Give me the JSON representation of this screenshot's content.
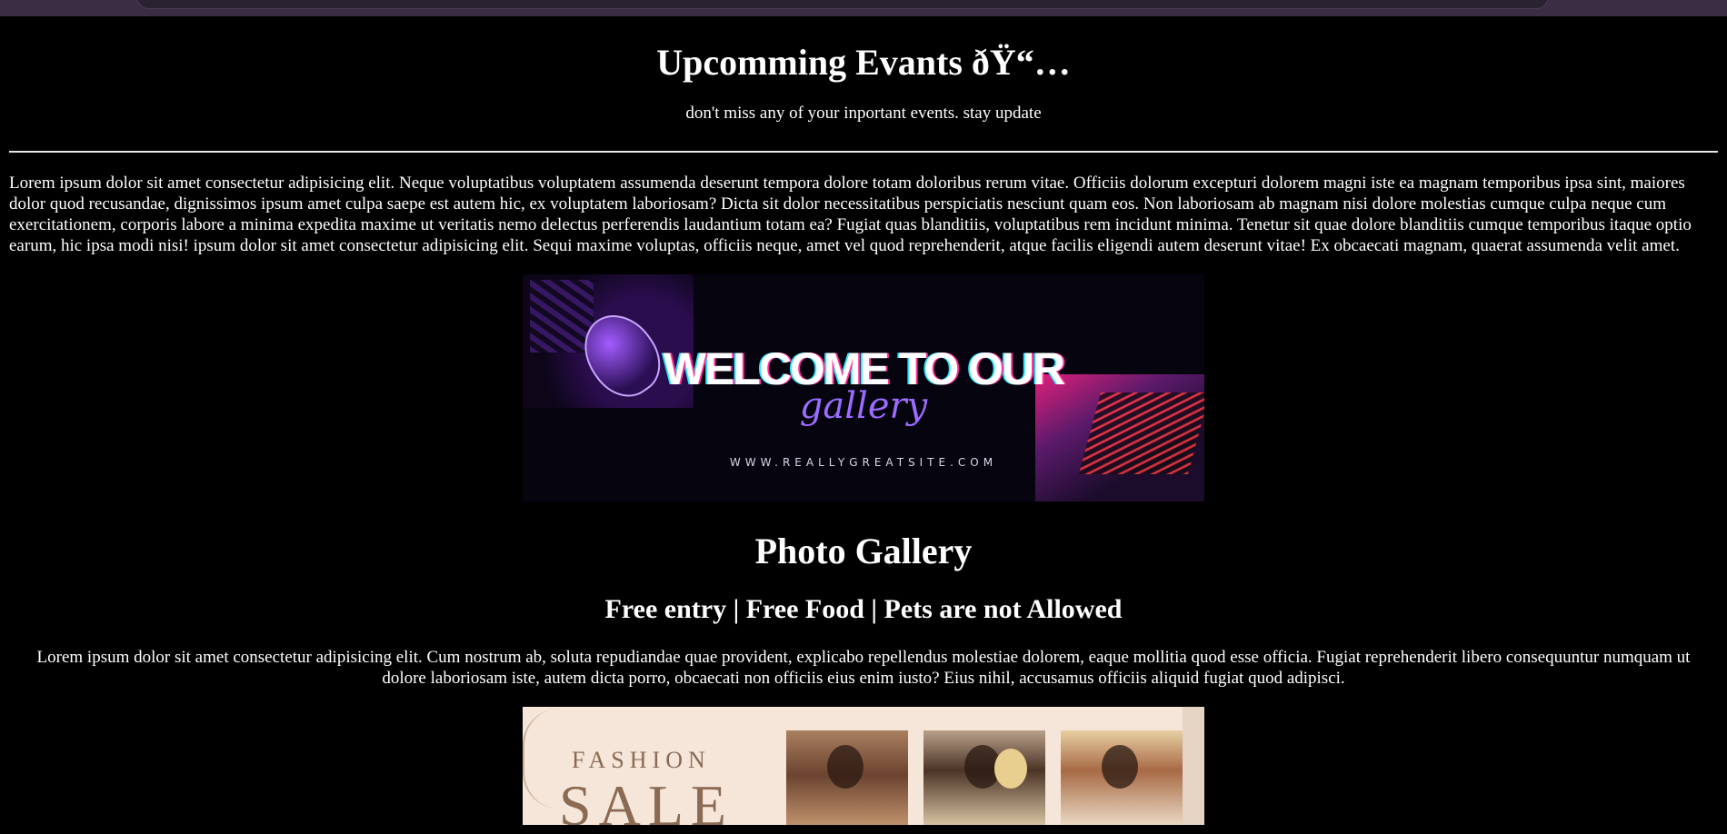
{
  "header": {
    "title": "Upcomming Evants ðŸ“…",
    "subtitle": "don't miss any of your inportant events. stay update"
  },
  "intro": {
    "paragraph": "Lorem ipsum dolor sit amet consectetur adipisicing elit. Neque voluptatibus voluptatem assumenda deserunt tempora dolore totam doloribus rerum vitae. Officiis dolorum excepturi dolorem magni iste ea magnam temporibus ipsa sint, maiores dolor quod recusandae, dignissimos ipsum amet culpa saepe est autem hic, ex voluptatem laboriosam? Dicta sit dolor necessitatibus perspiciatis nesciunt quam eos. Non laboriosam ab magnam nisi dolore molestias cumque culpa neque cum exercitationem, corporis labore a minima expedita maxime ut veritatis nemo delectus perferendis laudantium totam ea? Fugiat quas blanditiis, voluptatibus rem incidunt minima. Tenetur sit quae dolore blanditiis cumque temporibus itaque optio earum, hic ipsa modi nisi! ipsum dolor sit amet consectetur adipisicing elit. Sequi maxime voluptas, officiis neque, amet vel quod reprehenderit, atque facilis eligendi autem deserunt vitae! Ex obcaecati magnam, quaerat assumenda velit amet."
  },
  "welcome_banner": {
    "title": "WELCOME TO OUR",
    "script": "gallery",
    "url": "WWW.REALLYGREATSITE.COM"
  },
  "gallery": {
    "heading": "Photo Gallery",
    "info": "Free entry | Free Food | Pets are not Allowed",
    "paragraph": "Lorem ipsum dolor sit amet consectetur adipisicing elit. Cum nostrum ab, soluta repudiandae quae provident, explicabo repellendus molestiae dolorem, eaque mollitia quod esse officia. Fugiat reprehenderit libero consequuntur numquam ut dolore laboriosam iste, autem dicta porro, obcaecati non officiis eius enim iusto? Eius nihil, accusamus officiis aliquid fugiat quod adipisci."
  },
  "sale_banner": {
    "word": "FASHION",
    "big": "SALE"
  }
}
